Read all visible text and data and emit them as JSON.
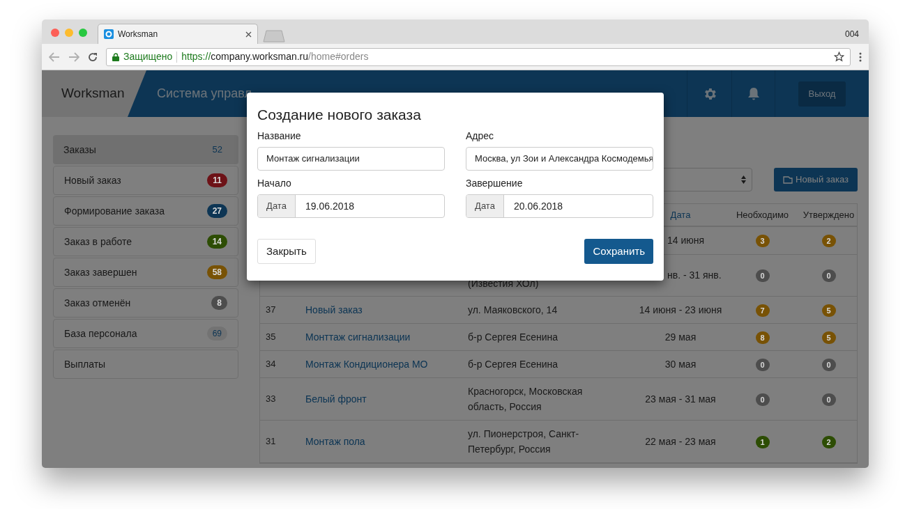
{
  "browser": {
    "tab": {
      "title": "Worksman"
    },
    "corner_label": "004",
    "security": "Защищено",
    "url": {
      "scheme": "https://",
      "host": "company.worksman.ru",
      "path": "/home#orders"
    }
  },
  "header": {
    "logo": "Worksman",
    "title": "Система управл",
    "logout": "Выход"
  },
  "sidebar": {
    "items": [
      {
        "label": "Заказы",
        "selected": true,
        "badge": {
          "text": "52",
          "kind": "plain"
        }
      },
      {
        "label": "Новый заказ",
        "selected": false,
        "badge": {
          "text": "11",
          "kind": "solid",
          "color": "#6d1217"
        }
      },
      {
        "label": "Формирование заказа",
        "selected": false,
        "badge": {
          "text": "27",
          "kind": "solid",
          "color": "#0d3554"
        }
      },
      {
        "label": "Заказ в работе",
        "selected": false,
        "badge": {
          "text": "14",
          "kind": "solid",
          "color": "#2d4d04"
        }
      },
      {
        "label": "Заказ завершен",
        "selected": false,
        "badge": {
          "text": "58",
          "kind": "solid",
          "color": "#785205"
        }
      },
      {
        "label": "Заказ отменён",
        "selected": false,
        "badge": {
          "text": "8",
          "kind": "solid",
          "color": "#4d4d4d"
        }
      },
      {
        "label": "База персонала",
        "selected": false,
        "badge": {
          "text": "69",
          "kind": "light"
        }
      },
      {
        "label": "Выплаты",
        "selected": false
      }
    ]
  },
  "toolbar": {
    "new_order_button": "Новый заказ"
  },
  "table": {
    "columns": [
      {
        "label": "Дата",
        "kind": "link"
      },
      {
        "label": "Необходимо",
        "kind": "plain"
      },
      {
        "label": "Утверждено",
        "kind": "plain"
      }
    ],
    "rows": [
      {
        "date": "14 июня",
        "needed": {
          "text": "3",
          "color": "#785205"
        },
        "approved": {
          "text": "2",
          "color": "#785205"
        }
      },
      {
        "address": "(Известия ХОл)",
        "date": "нв. - 31 янв.",
        "needed": {
          "text": "0",
          "color": "#4d4d4d"
        },
        "approved": {
          "text": "0",
          "color": "#4d4d4d"
        }
      },
      {
        "id": "37",
        "name": "Новый заказ",
        "address": "ул. Маяковского, 14",
        "date": "14 июня - 23 июня",
        "needed": {
          "text": "7",
          "color": "#785205"
        },
        "approved": {
          "text": "5",
          "color": "#785205"
        }
      },
      {
        "id": "35",
        "name": "Монттаж сигнализации",
        "address": "б-р Сергея Есенина",
        "date": "29 мая",
        "needed": {
          "text": "8",
          "color": "#785205"
        },
        "approved": {
          "text": "5",
          "color": "#785205"
        }
      },
      {
        "id": "34",
        "name": "Монтаж Кондиционера МО",
        "address": "б-р Сергея Есенина",
        "date": "30 мая",
        "needed": {
          "text": "0",
          "color": "#4d4d4d"
        },
        "approved": {
          "text": "0",
          "color": "#4d4d4d"
        }
      },
      {
        "id": "33",
        "name": "Белый фронт",
        "address": "Красногорск, Московская область, Россия",
        "date": "23 мая - 31 мая",
        "needed": {
          "text": "0",
          "color": "#4d4d4d"
        },
        "approved": {
          "text": "0",
          "color": "#4d4d4d"
        }
      },
      {
        "id": "31",
        "name": "Монтаж пола",
        "address": "ул. Пионерстроя, Санкт-Петербург, Россия",
        "date": "22 мая - 23 мая",
        "needed": {
          "text": "1",
          "color": "#2d4d04"
        },
        "approved": {
          "text": "2",
          "color": "#2d4d04"
        }
      }
    ]
  },
  "modal": {
    "title": "Создание нового заказа",
    "fields": [
      {
        "label": "Название",
        "value": "Монтаж сигнализации"
      },
      {
        "label": "Адрес",
        "value": "Москва, ул Зои и Александра Космодемья"
      },
      {
        "label": "Начало",
        "addon": "Дата",
        "value": "19.06.2018"
      },
      {
        "label": "Завершение",
        "addon": "Дата",
        "value": "20.06.2018"
      }
    ],
    "close_button": "Закрыть",
    "save_button": "Сохранить"
  }
}
